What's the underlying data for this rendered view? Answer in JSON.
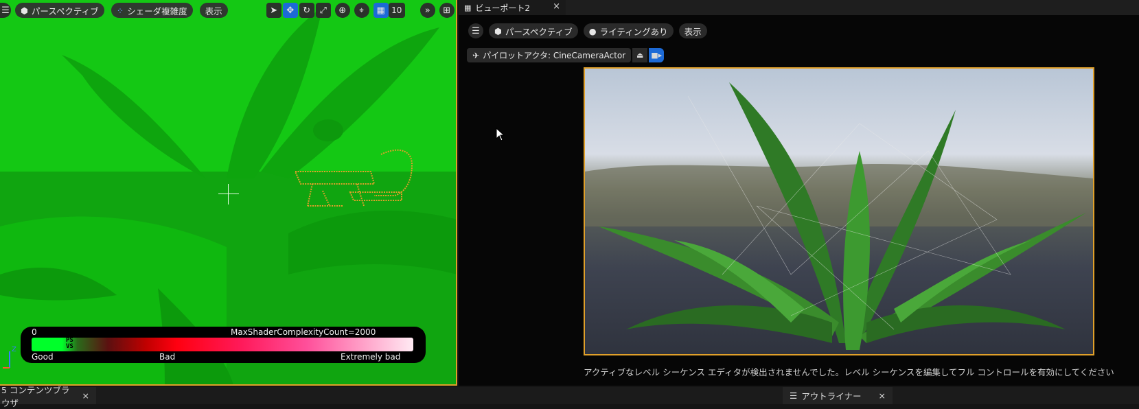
{
  "left_viewport": {
    "menu_icon": "hamburger-icon",
    "perspective_label": "パースペクティブ",
    "view_mode_label": "シェーダ複雑度",
    "show_label": "表示",
    "grid_snap_value": "10",
    "legend": {
      "min_value": "0",
      "max_label": "MaxShaderComplexityCount=2000",
      "ps_label": "PS",
      "vs_label": "VS",
      "good_label": "Good",
      "bad_label": "Bad",
      "extremely_bad_label": "Extremely bad"
    },
    "axis_z_label": "Z",
    "colors": {
      "background": "#14c814",
      "selection_outline": "#e0a02a"
    }
  },
  "right_viewport": {
    "tab_title": "ビューポート2",
    "tab_close": "×",
    "perspective_label": "パースペクティブ",
    "lighting_label": "ライティングあり",
    "show_label": "表示",
    "pilot_label": "パイロットアクタ: CineCameraActor",
    "status_message": "アクティブなレベル シーケンス エディタが検出されませんでした。レベル シーケンスを編集してフル コントロールを有効にしてください"
  },
  "bottom_tabs": {
    "content_browser_label": "5 コンテンツブラウザ",
    "content_browser_close": "×",
    "outliner_label": "アウトライナー",
    "outliner_close": "×"
  }
}
